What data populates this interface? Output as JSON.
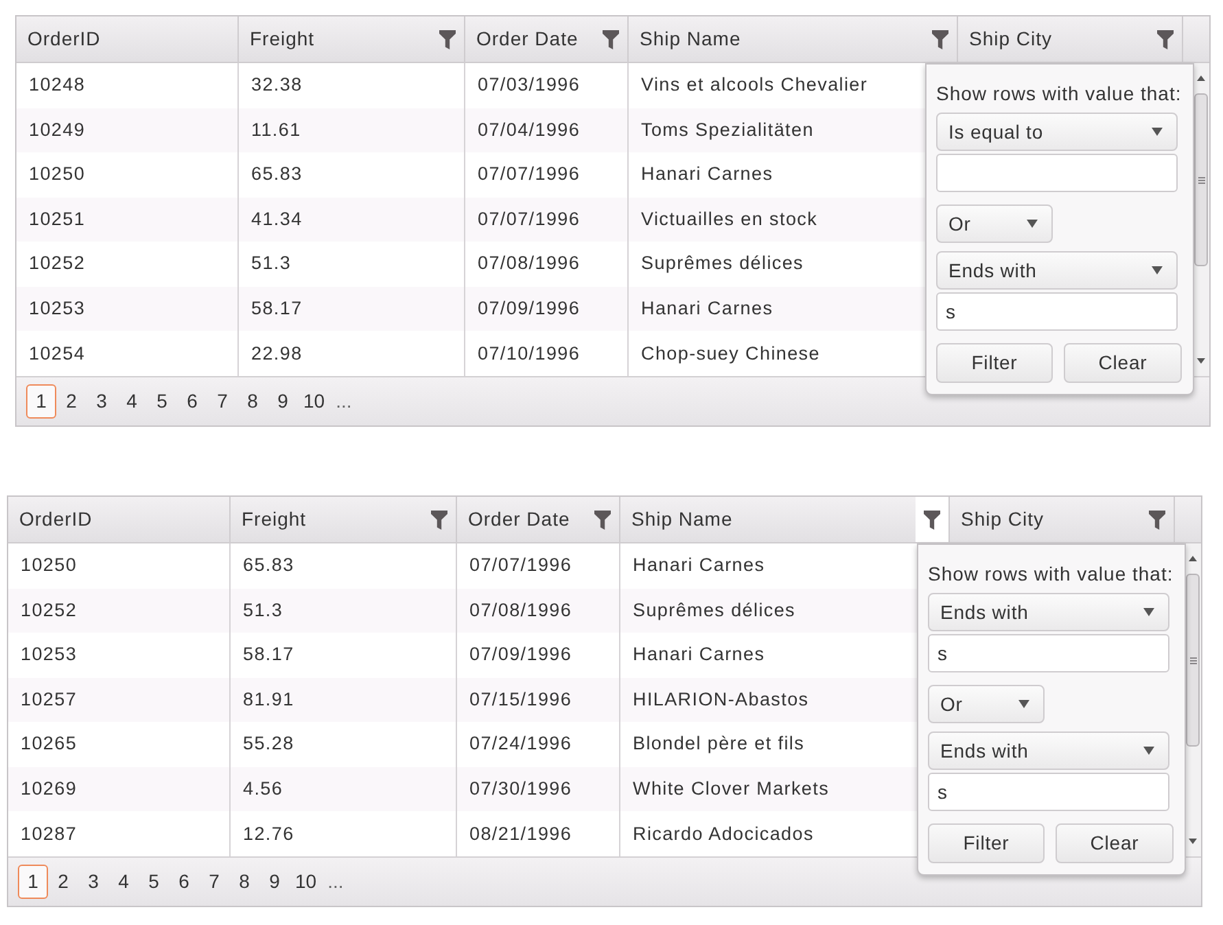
{
  "grids": [
    {
      "columns": [
        {
          "label": "OrderID",
          "filter": false,
          "filter_open": false
        },
        {
          "label": "Freight",
          "filter": true,
          "filter_open": false
        },
        {
          "label": "Order Date",
          "filter": true,
          "filter_open": false
        },
        {
          "label": "Ship Name",
          "filter": true,
          "filter_open": false
        },
        {
          "label": "Ship City",
          "filter": true,
          "filter_open": false
        }
      ],
      "rows": [
        [
          "10248",
          "32.38",
          "07/03/1996",
          "Vins et alcools Chevalier"
        ],
        [
          "10249",
          "11.61",
          "07/04/1996",
          "Toms Spezialitäten"
        ],
        [
          "10250",
          "65.83",
          "07/07/1996",
          "Hanari Carnes"
        ],
        [
          "10251",
          "41.34",
          "07/07/1996",
          "Victuailles en stock"
        ],
        [
          "10252",
          "51.3",
          "07/08/1996",
          "Suprêmes délices"
        ],
        [
          "10253",
          "58.17",
          "07/09/1996",
          "Hanari Carnes"
        ],
        [
          "10254",
          "22.98",
          "07/10/1996",
          "Chop-suey Chinese"
        ]
      ],
      "pager": {
        "pages": [
          {
            "label": "1",
            "selected": true
          },
          {
            "label": "2",
            "selected": false
          },
          {
            "label": "3",
            "selected": false
          },
          {
            "label": "4",
            "selected": false
          },
          {
            "label": "5",
            "selected": false
          },
          {
            "label": "6",
            "selected": false
          },
          {
            "label": "7",
            "selected": false
          },
          {
            "label": "8",
            "selected": false
          },
          {
            "label": "9",
            "selected": false
          },
          {
            "label": "10",
            "selected": false
          }
        ],
        "more": "..."
      },
      "filter_menu": {
        "prompt": "Show rows with value that:",
        "conditions": [
          {
            "operator": "Is equal to"
          },
          {
            "operator": "Ends with",
            "value": "s"
          }
        ],
        "logic": "Or",
        "buttons": [
          "Filter",
          "Clear"
        ]
      }
    },
    {
      "columns": [
        {
          "label": "OrderID",
          "filter": false,
          "filter_open": false
        },
        {
          "label": "Freight",
          "filter": true,
          "filter_open": false
        },
        {
          "label": "Order Date",
          "filter": true,
          "filter_open": false
        },
        {
          "label": "Ship Name",
          "filter": true,
          "filter_open": true
        },
        {
          "label": "Ship City",
          "filter": true,
          "filter_open": false
        }
      ],
      "rows": [
        [
          "10250",
          "65.83",
          "07/07/1996",
          "Hanari Carnes"
        ],
        [
          "10252",
          "51.3",
          "07/08/1996",
          "Suprêmes délices"
        ],
        [
          "10253",
          "58.17",
          "07/09/1996",
          "Hanari Carnes"
        ],
        [
          "10257",
          "81.91",
          "07/15/1996",
          "HILARION-Abastos"
        ],
        [
          "10265",
          "55.28",
          "07/24/1996",
          "Blondel père et fils"
        ],
        [
          "10269",
          "4.56",
          "07/30/1996",
          "White Clover Markets"
        ],
        [
          "10287",
          "12.76",
          "08/21/1996",
          "Ricardo Adocicados"
        ]
      ],
      "pager": {
        "pages": [
          {
            "label": "1",
            "selected": true
          },
          {
            "label": "2",
            "selected": false
          },
          {
            "label": "3",
            "selected": false
          },
          {
            "label": "4",
            "selected": false
          },
          {
            "label": "5",
            "selected": false
          },
          {
            "label": "6",
            "selected": false
          },
          {
            "label": "7",
            "selected": false
          },
          {
            "label": "8",
            "selected": false
          },
          {
            "label": "9",
            "selected": false
          },
          {
            "label": "10",
            "selected": false
          }
        ],
        "more": "..."
      },
      "filter_menu": {
        "prompt": "Show rows with value that:",
        "conditions": [
          {
            "operator": "Ends with",
            "value": "s"
          },
          {
            "operator": "Ends with",
            "value": "s"
          }
        ],
        "logic": "Or",
        "buttons": [
          "Filter",
          "Clear"
        ]
      }
    }
  ]
}
